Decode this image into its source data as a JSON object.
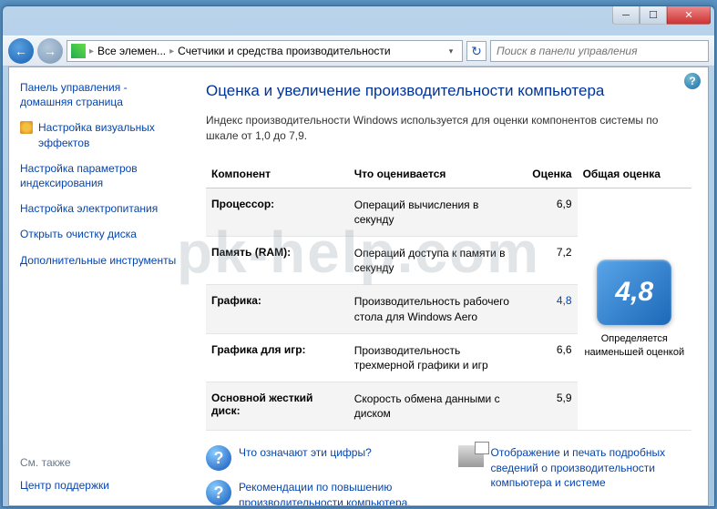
{
  "breadcrumb": {
    "item1": "Все элемен...",
    "item2": "Счетчики и средства производительности"
  },
  "search": {
    "placeholder": "Поиск в панели управления"
  },
  "sidebar": {
    "home": "Панель управления - домашняя страница",
    "visual": "Настройка визуальных эффектов",
    "index": "Настройка параметров индексирования",
    "power": "Настройка электропитания",
    "cleanup": "Открыть очистку диска",
    "tools": "Дополнительные инструменты",
    "see_also": "См. также",
    "support": "Центр поддержки"
  },
  "main": {
    "title": "Оценка и увеличение производительности компьютера",
    "intro": "Индекс производительности Windows используется для оценки компонентов системы по шкале от 1,0 до 7,9."
  },
  "table": {
    "h_comp": "Компонент",
    "h_desc": "Что оценивается",
    "h_score": "Оценка",
    "h_base": "Общая оценка",
    "rows": [
      {
        "comp": "Процессор:",
        "desc": "Операций вычисления в секунду",
        "score": "6,9"
      },
      {
        "comp": "Память (RAM):",
        "desc": "Операций доступа к памяти в секунду",
        "score": "7,2"
      },
      {
        "comp": "Графика:",
        "desc": "Производительность рабочего стола для Windows Aero",
        "score": "4,8"
      },
      {
        "comp": "Графика для игр:",
        "desc": "Производительность трехмерной графики и игр",
        "score": "6,6"
      },
      {
        "comp": "Основной жесткий диск:",
        "desc": "Скорость обмена данными с диском",
        "score": "5,9"
      }
    ],
    "base_score": "4,8",
    "base_text": "Определяется наименьшей оценкой"
  },
  "links": {
    "what": "Что означают эти цифры?",
    "tips": "Рекомендации по повышению производительности компьютера.",
    "print": "Отображение и печать подробных сведений о производительности компьютера и системе"
  },
  "watermark": "pk-help.com"
}
